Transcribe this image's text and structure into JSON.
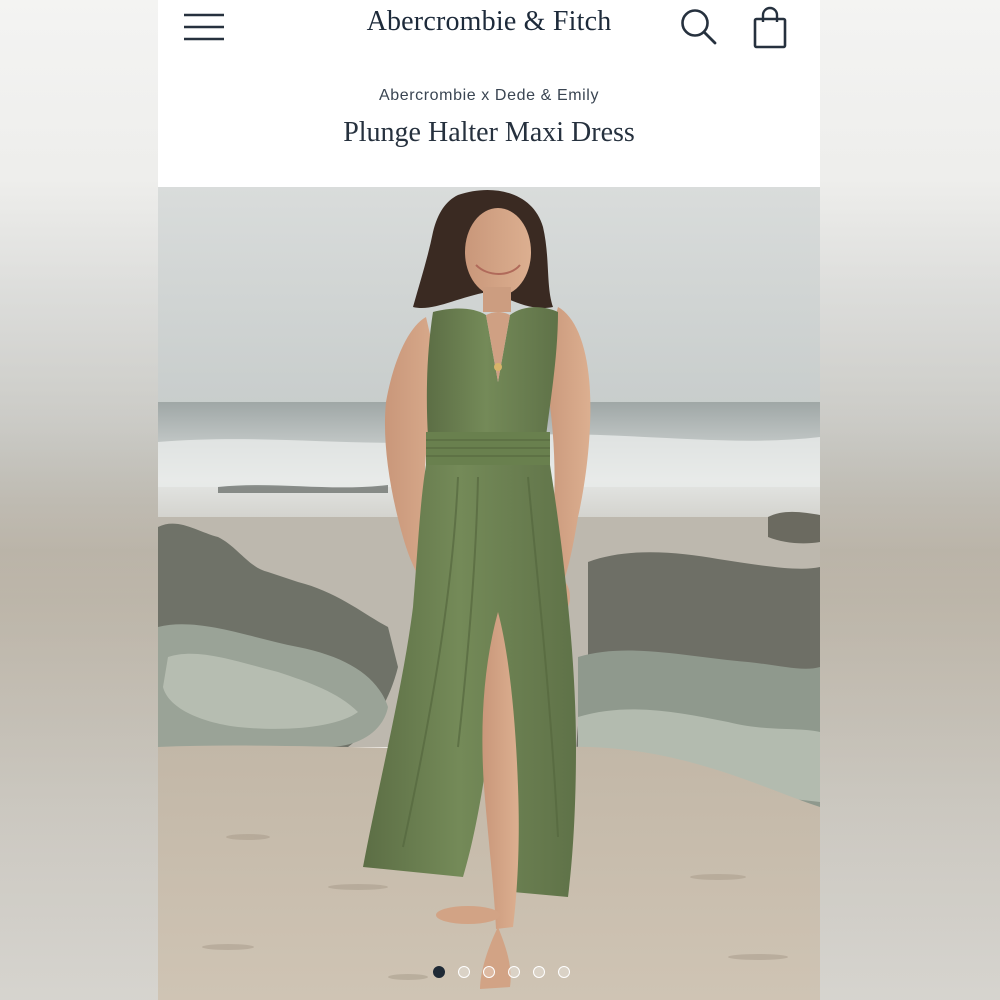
{
  "header": {
    "brand": "Abercrombie & Fitch",
    "menu_icon": "hamburger-menu-icon",
    "search_icon": "search-icon",
    "bag_icon": "shopping-bag-icon"
  },
  "product": {
    "collaboration": "Abercrombie x Dede & Emily",
    "title": "Plunge Halter Maxi Dress",
    "dress_color": "#6f8455"
  },
  "carousel": {
    "image_count": 6,
    "active_index": 0
  },
  "colors": {
    "brand_text": "#1d2a3a",
    "active_dot": "#1f2a36"
  }
}
